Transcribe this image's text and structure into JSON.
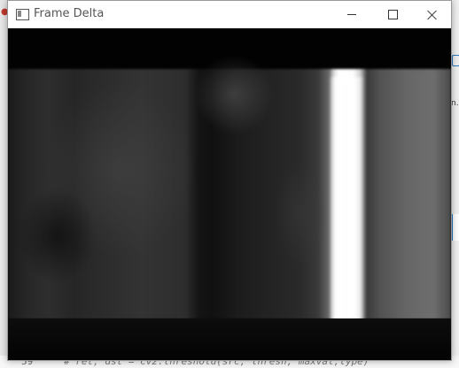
{
  "window": {
    "title": "Frame Delta"
  },
  "icons": {
    "app": "app-window-icon",
    "minimize": "minimize-icon",
    "maximize": "maximize-icon",
    "close": "close-icon"
  },
  "background_editor": {
    "line_number": "59",
    "code_text": "# ret, dst = cv2.threshold(src, thresh, maxval,type)",
    "right_edge_text": "n."
  },
  "colors": {
    "titlebar_bg": "#ffffff",
    "frame_bg": "#000000",
    "accent_blue": "#2b79c2"
  }
}
